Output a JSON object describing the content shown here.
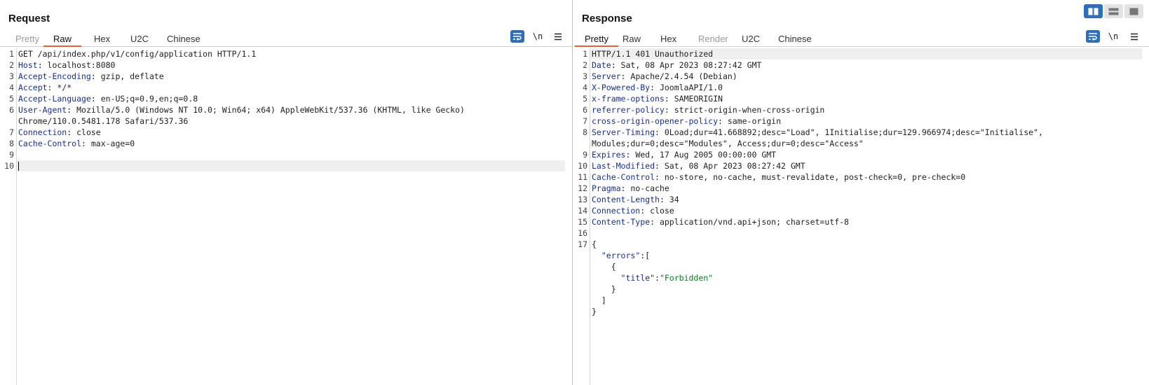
{
  "request": {
    "title": "Request",
    "tabs": [
      {
        "label": "Pretty",
        "state": "disabled"
      },
      {
        "label": "Raw",
        "state": "active"
      },
      {
        "label": "Hex",
        "state": "normal"
      },
      {
        "label": "U2C",
        "state": "normal"
      },
      {
        "label": "Chinese",
        "state": "normal"
      }
    ],
    "tools": {
      "newline_label": "\\n"
    },
    "lines": [
      {
        "n": "1",
        "key": "",
        "rest": "GET /api/index.php/v1/config/application HTTP/1.1"
      },
      {
        "n": "2",
        "key": "Host",
        "rest": ": localhost:8080"
      },
      {
        "n": "3",
        "key": "Accept-Encoding",
        "rest": ": gzip, deflate"
      },
      {
        "n": "4",
        "key": "Accept",
        "rest": ": */*"
      },
      {
        "n": "5",
        "key": "Accept-Language",
        "rest": ": en-US;q=0.9,en;q=0.8"
      },
      {
        "n": "6",
        "key": "User-Agent",
        "rest": ": Mozilla/5.0 (Windows NT 10.0; Win64; x64) AppleWebKit/537.36 (KHTML, like Gecko)"
      },
      {
        "n": "",
        "key": "",
        "rest": "Chrome/110.0.5481.178 Safari/537.36"
      },
      {
        "n": "7",
        "key": "Connection",
        "rest": ": close"
      },
      {
        "n": "8",
        "key": "Cache-Control",
        "rest": ": max-age=0"
      },
      {
        "n": "9",
        "key": "",
        "rest": ""
      },
      {
        "n": "10",
        "key": "",
        "rest": "",
        "current": true
      }
    ]
  },
  "response": {
    "title": "Response",
    "tabs": [
      {
        "label": "Pretty",
        "state": "active"
      },
      {
        "label": "Raw",
        "state": "normal"
      },
      {
        "label": "Hex",
        "state": "normal"
      },
      {
        "label": "Render",
        "state": "disabled"
      },
      {
        "label": "U2C",
        "state": "normal"
      },
      {
        "label": "Chinese",
        "state": "normal"
      }
    ],
    "tools": {
      "newline_label": "\\n"
    },
    "lines": [
      {
        "n": "1",
        "key": "",
        "rest": "HTTP/1.1 401 Unauthorized",
        "current": true
      },
      {
        "n": "2",
        "key": "Date",
        "rest": ": Sat, 08 Apr 2023 08:27:42 GMT"
      },
      {
        "n": "3",
        "key": "Server",
        "rest": ": Apache/2.4.54 (Debian)"
      },
      {
        "n": "4",
        "key": "X-Powered-By",
        "rest": ": JoomlaAPI/1.0"
      },
      {
        "n": "5",
        "key": "x-frame-options",
        "rest": ": SAMEORIGIN"
      },
      {
        "n": "6",
        "key": "referrer-policy",
        "rest": ": strict-origin-when-cross-origin"
      },
      {
        "n": "7",
        "key": "cross-origin-opener-policy",
        "rest": ": same-origin"
      },
      {
        "n": "8",
        "key": "Server-Timing",
        "rest": ": 0Load;dur=41.668892;desc=\"Load\", 1Initialise;dur=129.966974;desc=\"Initialise\","
      },
      {
        "n": "",
        "key": "",
        "rest": "Modules;dur=0;desc=\"Modules\", Access;dur=0;desc=\"Access\""
      },
      {
        "n": "9",
        "key": "Expires",
        "rest": ": Wed, 17 Aug 2005 00:00:00 GMT"
      },
      {
        "n": "10",
        "key": "Last-Modified",
        "rest": ": Sat, 08 Apr 2023 08:27:42 GMT"
      },
      {
        "n": "11",
        "key": "Cache-Control",
        "rest": ": no-store, no-cache, must-revalidate, post-check=0, pre-check=0"
      },
      {
        "n": "12",
        "key": "Pragma",
        "rest": ": no-cache"
      },
      {
        "n": "13",
        "key": "Content-Length",
        "rest": ": 34"
      },
      {
        "n": "14",
        "key": "Connection",
        "rest": ": close"
      },
      {
        "n": "15",
        "key": "Content-Type",
        "rest": ": application/vnd.api+json; charset=utf-8"
      },
      {
        "n": "16",
        "key": "",
        "rest": ""
      },
      {
        "n": "17",
        "key": "",
        "rest": "{"
      },
      {
        "n": "",
        "key": "",
        "rest": "  ",
        "jkey": "\"errors\"",
        "jafter": ":["
      },
      {
        "n": "",
        "key": "",
        "rest": "    {"
      },
      {
        "n": "",
        "key": "",
        "rest": "      ",
        "jkey": "\"title\"",
        "jafter": ":",
        "jstr": "\"Forbidden\""
      },
      {
        "n": "",
        "key": "",
        "rest": "    }"
      },
      {
        "n": "",
        "key": "",
        "rest": "  ]"
      },
      {
        "n": "",
        "key": "",
        "rest": "}"
      }
    ]
  },
  "colors": {
    "accent": "#e8612c",
    "brand": "#2f6db5",
    "header_key": "#1a2f8a",
    "json_string": "#117a26"
  }
}
